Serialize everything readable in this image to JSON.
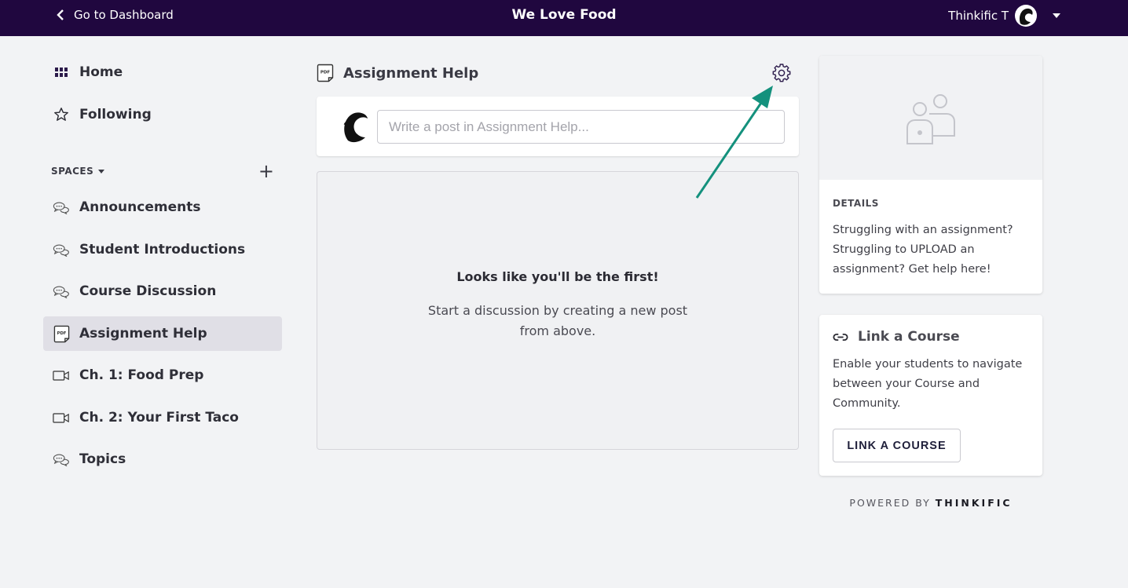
{
  "topbar": {
    "back_label": "Go to Dashboard",
    "site_title": "We Love Food",
    "user_name": "Thinkific T"
  },
  "sidebar": {
    "home": "Home",
    "following": "Following",
    "spaces_label": "SPACES",
    "add_symbol": "+",
    "items": [
      {
        "label": "Announcements",
        "icon": "chat-bubbles-icon"
      },
      {
        "label": "Student Introductions",
        "icon": "chat-bubbles-icon"
      },
      {
        "label": "Course Discussion",
        "icon": "chat-bubbles-icon"
      },
      {
        "label": "Assignment Help",
        "icon": "pdf-icon",
        "active": true
      },
      {
        "label": "Ch. 1: Food Prep",
        "icon": "video-icon"
      },
      {
        "label": "Ch. 2: Your First Taco",
        "icon": "video-icon"
      },
      {
        "label": "Topics",
        "icon": "chat-bubbles-icon"
      }
    ]
  },
  "space": {
    "title": "Assignment Help",
    "composer_placeholder": "Write a post in Assignment Help...",
    "empty_title": "Looks like you'll be the first!",
    "empty_text": "Start a discussion by creating a new post from above."
  },
  "details": {
    "label": "DETAILS",
    "text": "Struggling with an assignment? Struggling to UPLOAD an assignment? Get help here!"
  },
  "link_course": {
    "title": "Link a Course",
    "text": "Enable your students to navigate between your Course and Community.",
    "button": "LINK A COURSE"
  },
  "footer": {
    "powered_by": "POWERED BY",
    "brand": "THINKIFIC"
  },
  "colors": {
    "topbar": "#20073f",
    "active_item": "#e0dfe6",
    "annotation_arrow": "#14917d"
  }
}
